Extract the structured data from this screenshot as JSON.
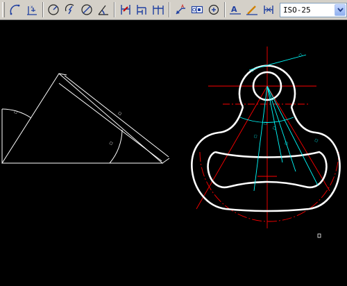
{
  "toolbar": {
    "tools": [
      {
        "name": "dimension-arc-icon"
      },
      {
        "name": "dimension-ordinate-icon"
      },
      {
        "name": "dimension-radius-icon"
      },
      {
        "name": "dimension-jogged-icon"
      },
      {
        "name": "dimension-diameter-icon"
      },
      {
        "name": "dimension-angular-icon"
      },
      {
        "name": "quick-dimension-icon"
      },
      {
        "name": "dimension-baseline-icon"
      },
      {
        "name": "dimension-continue-icon"
      },
      {
        "name": "quick-leader-icon"
      },
      {
        "name": "tolerance-icon"
      },
      {
        "name": "center-mark-icon"
      },
      {
        "name": "dimension-edit-icon"
      },
      {
        "name": "dimension-text-edit-icon"
      },
      {
        "name": "dimension-update-icon"
      }
    ],
    "dimstyle": {
      "value": "ISO-25"
    }
  },
  "drawing": {
    "colors": {
      "background": "#000000",
      "geometry": "#ffffff",
      "centerlines": "#ff0000",
      "dimensions": "#00ffff"
    }
  }
}
